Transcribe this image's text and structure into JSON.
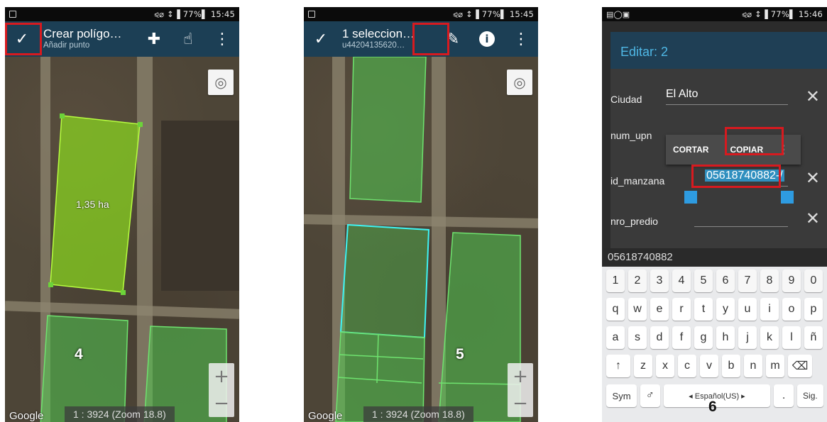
{
  "status_bar": {
    "indicators": "⪨⌀ ↕▐ 77%▌ 15:45",
    "time": "15:45",
    "battery": "77%"
  },
  "phone1": {
    "toolbar": {
      "confirm_icon": "✓",
      "title": "Crear polígo…",
      "subtitle": "Añadir punto",
      "move_icon": "✚",
      "touch_icon": "☝",
      "menu_icon": "⋮"
    },
    "polygon_area": "1,35 ha",
    "step": "4",
    "google": "Google",
    "scale": "1 : 3924 (Zoom 18.8)",
    "zoom_in": "+",
    "zoom_out": "−",
    "locate_icon": "◎"
  },
  "phone2": {
    "toolbar": {
      "confirm_icon": "✓",
      "title": "1 seleccion…",
      "subtitle": "u44204135620…",
      "edit_icon": "✎",
      "info_icon": "i",
      "menu_icon": "⋮"
    },
    "step": "5",
    "google": "Google",
    "scale": "1 : 3924 (Zoom 18.8)",
    "zoom_in": "+",
    "zoom_out": "−",
    "locate_icon": "◎"
  },
  "phone3": {
    "status_left": "▤◯▣",
    "status_right": "⪨⌀ ↕▐ 77%▌ 15:46",
    "dialog_title": "Editar: 2",
    "fields": [
      {
        "label": "Ciudad",
        "value": "El Alto"
      },
      {
        "label": "num_upn",
        "value": ""
      },
      {
        "label": "id_manzana",
        "value": "05618740882-/"
      },
      {
        "label": "nro_predio",
        "value": ""
      }
    ],
    "clear_icon": "✕",
    "context_menu": {
      "cut": "CORTAR",
      "copy": "COPIAR",
      "more": "⋮"
    },
    "suggestion": "05618740882",
    "keyboard": {
      "row1": [
        "1",
        "2",
        "3",
        "4",
        "5",
        "6",
        "7",
        "8",
        "9",
        "0"
      ],
      "row2": [
        "q",
        "w",
        "e",
        "r",
        "t",
        "y",
        "u",
        "i",
        "o",
        "p"
      ],
      "row3": [
        "a",
        "s",
        "d",
        "f",
        "g",
        "h",
        "j",
        "k",
        "l",
        "ñ"
      ],
      "row4": [
        "↑",
        "z",
        "x",
        "c",
        "v",
        "b",
        "n",
        "m",
        "⌫"
      ],
      "sym": "Sym",
      "mic": "♂",
      "space": "◂ Español(US) ▸",
      "period": ".",
      "next": "Sig."
    },
    "step": "6"
  }
}
